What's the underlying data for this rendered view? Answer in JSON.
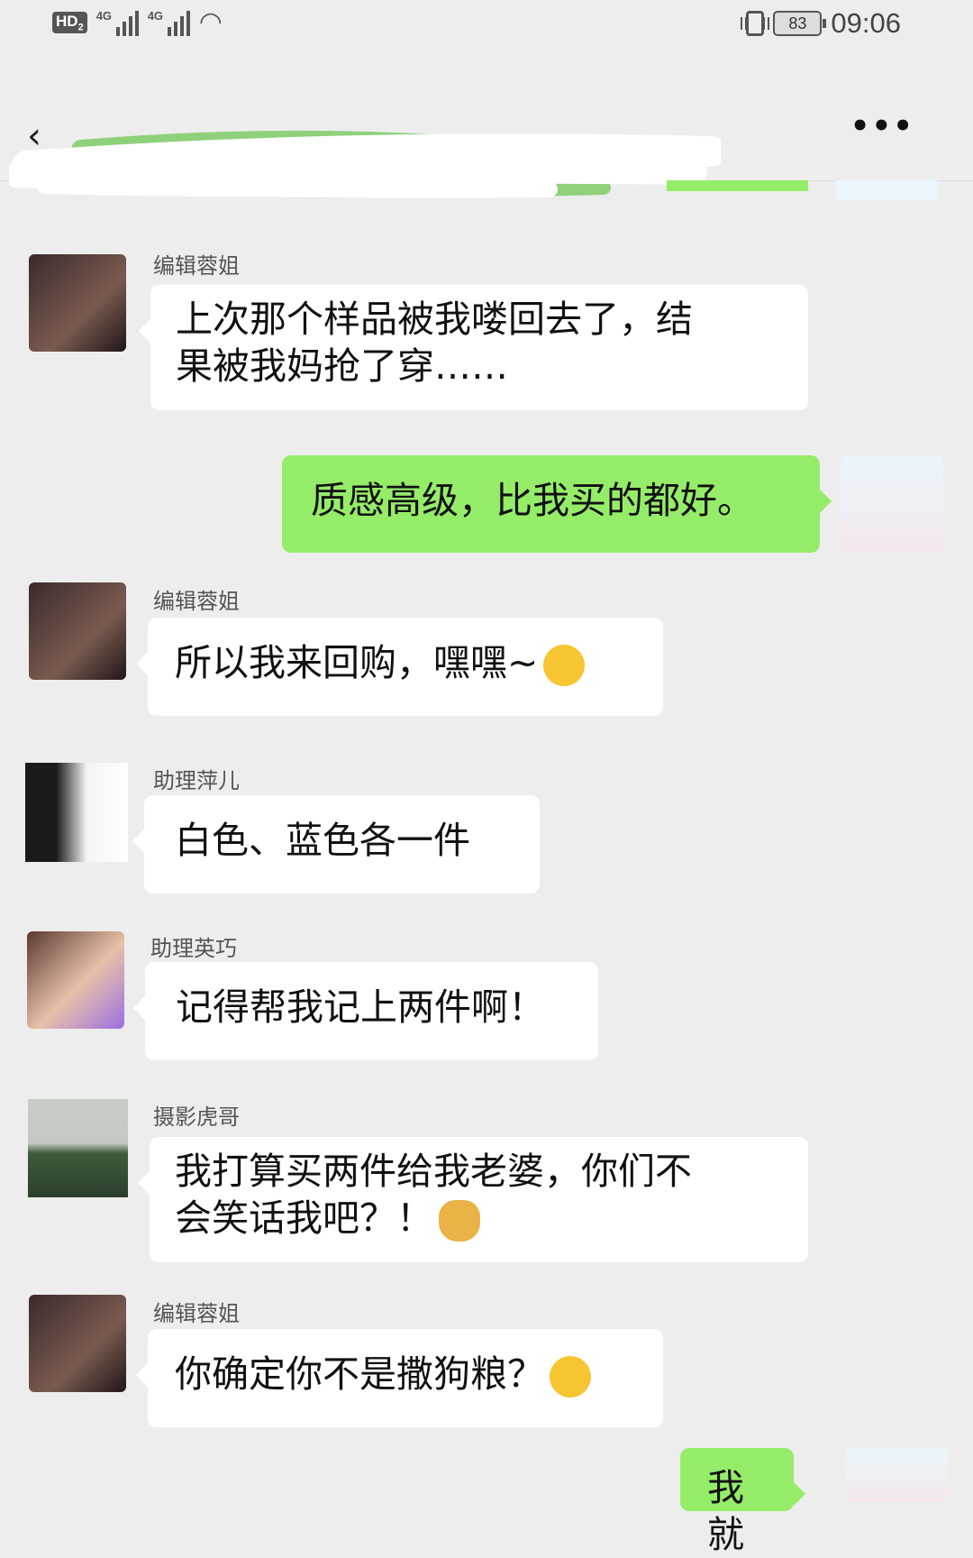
{
  "status_bar": {
    "hd": "HD",
    "hd_sub": "2",
    "net1": "4G",
    "net2": "4G",
    "battery": "83",
    "time": "09:06"
  },
  "header": {
    "back_icon": "back-chevron-icon",
    "more_label": "•••"
  },
  "messages": [
    {
      "sender": "编辑蓉姐",
      "line1": "上次那个样品被我喽回去了，结",
      "line2": "果被我妈抢了穿……"
    },
    {
      "sender": "",
      "text": "质感高级，比我买的都好。"
    },
    {
      "sender": "编辑蓉姐",
      "text": "所以我来回购，嘿嘿~"
    },
    {
      "sender": "助理萍儿",
      "text": "白色、蓝色各一件"
    },
    {
      "sender": "助理英巧",
      "text": "记得帮我记上两件啊！"
    },
    {
      "sender": "摄影虎哥",
      "line1": "我打算买两件给我老婆，你们不",
      "line2": "会笑话我吧？！"
    },
    {
      "sender": "编辑蓉姐",
      "text": "你确定你不是撒狗粮？"
    },
    {
      "sender": "",
      "text": "我就"
    }
  ],
  "colors": {
    "background": "#ededed",
    "my_bubble": "#95ec69",
    "other_bubble": "#ffffff"
  }
}
